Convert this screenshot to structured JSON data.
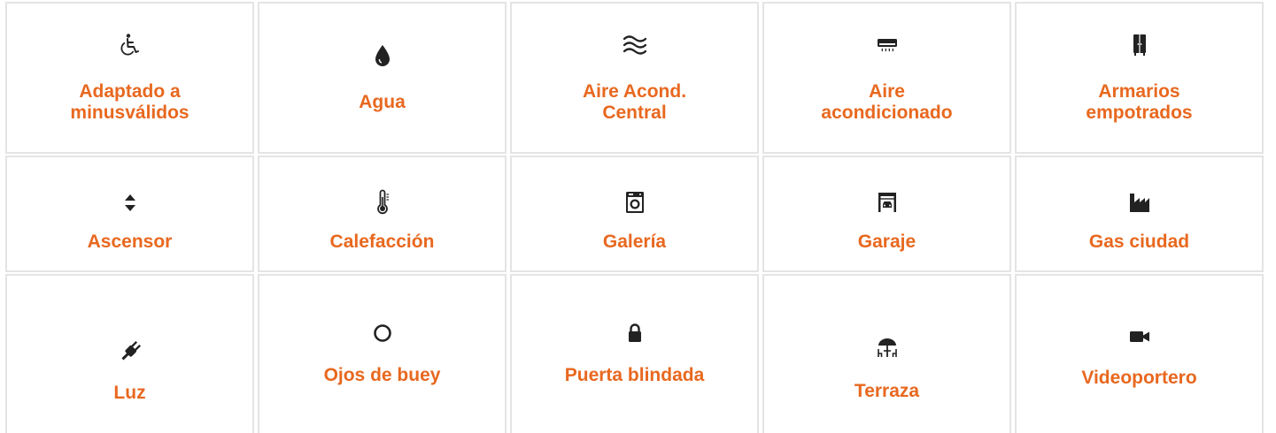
{
  "features": [
    {
      "label": "Adaptado a\nminusválidos",
      "icon": "wheelchair-icon"
    },
    {
      "label": "Agua",
      "icon": "water-drop-icon"
    },
    {
      "label": "Aire Acond.\nCentral",
      "icon": "air-waves-icon"
    },
    {
      "label": "Aire\nacondicionado",
      "icon": "air-conditioner-icon"
    },
    {
      "label": "Armarios\nempotrados",
      "icon": "wardrobe-icon"
    },
    {
      "label": "Ascensor",
      "icon": "elevator-arrows-icon"
    },
    {
      "label": "Calefacción",
      "icon": "thermometer-icon"
    },
    {
      "label": "Galería",
      "icon": "washing-machine-icon"
    },
    {
      "label": "Garaje",
      "icon": "garage-car-icon"
    },
    {
      "label": "Gas ciudad",
      "icon": "factory-icon"
    },
    {
      "label": "Luz",
      "icon": "plug-icon"
    },
    {
      "label": "Ojos de buey",
      "icon": "circle-icon"
    },
    {
      "label": "Puerta blindada",
      "icon": "lock-icon"
    },
    {
      "label": "Terraza",
      "icon": "terrace-umbrella-icon"
    },
    {
      "label": "Videoportero",
      "icon": "video-camera-icon"
    }
  ],
  "colors": {
    "label": "#e8681f",
    "icon": "#222222",
    "border": "#e4e4e4"
  }
}
